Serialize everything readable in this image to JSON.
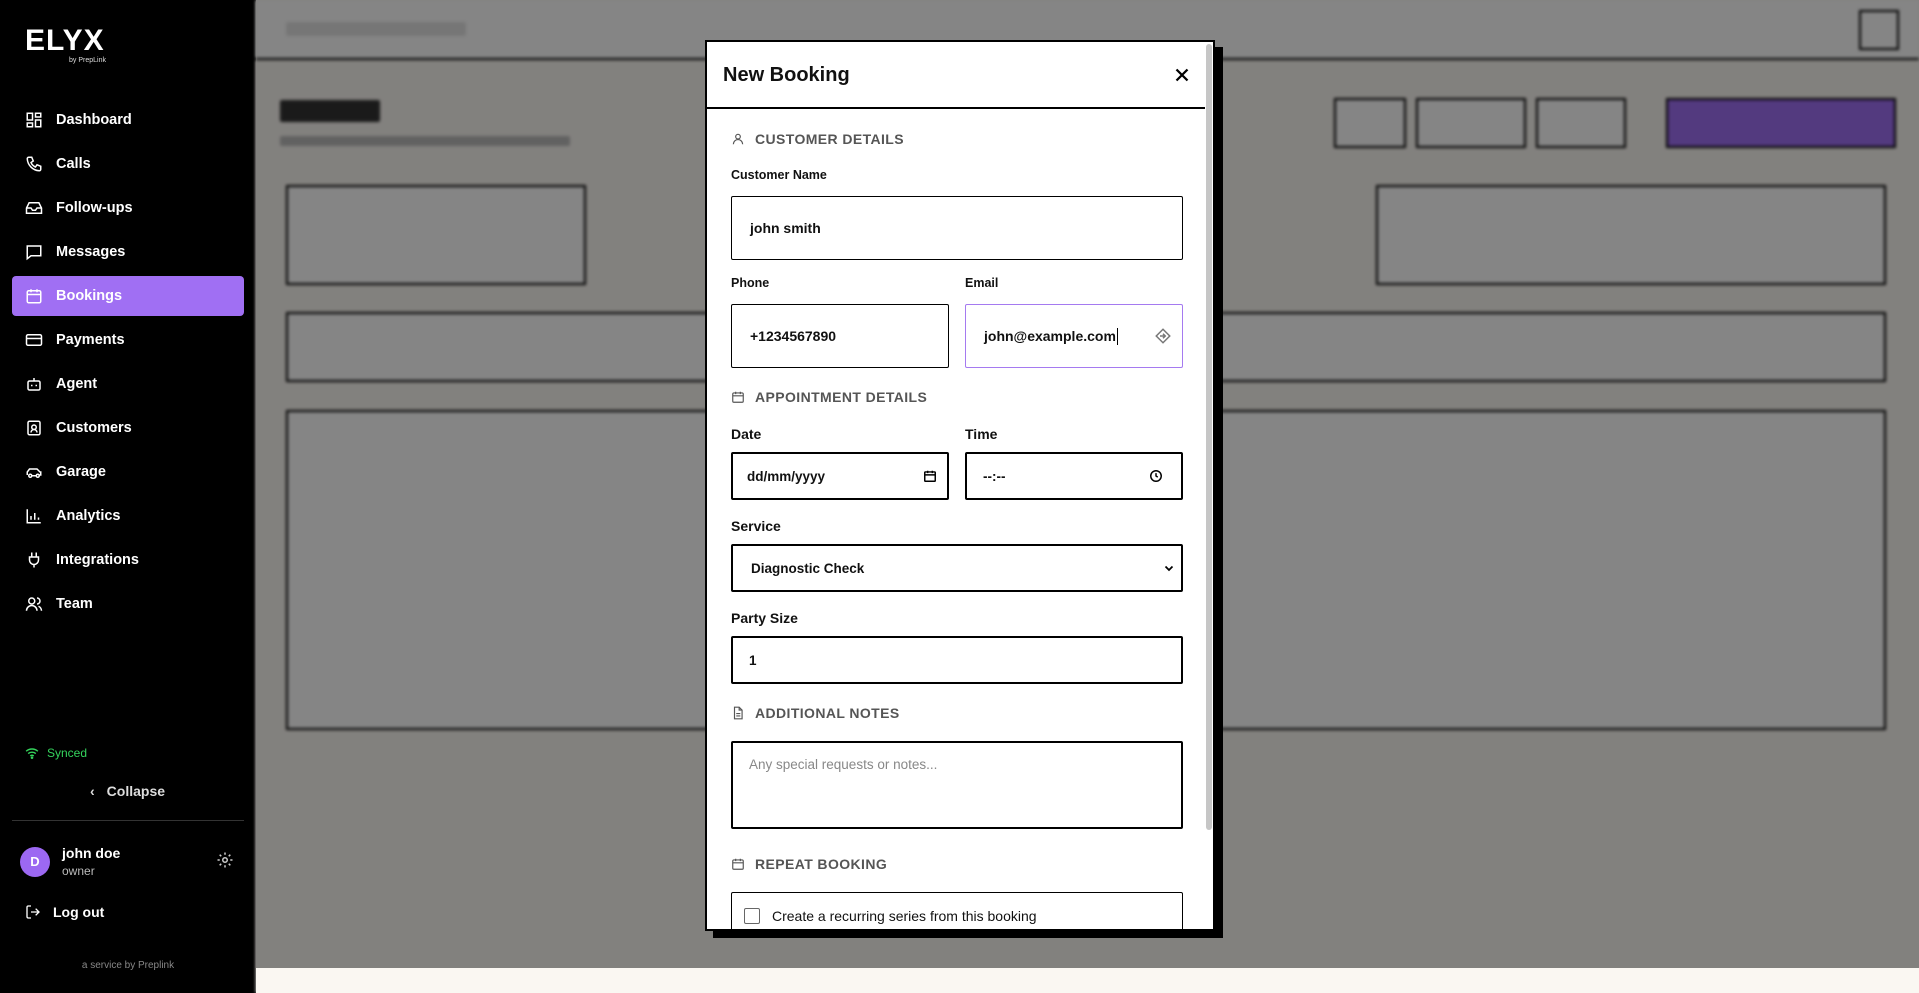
{
  "brand": {
    "name": "ELYX",
    "tagline": "by PrepLink"
  },
  "sidebar": {
    "items": [
      {
        "label": "Dashboard",
        "icon": "grid-icon"
      },
      {
        "label": "Calls",
        "icon": "phone-icon"
      },
      {
        "label": "Follow-ups",
        "icon": "inbox-icon"
      },
      {
        "label": "Messages",
        "icon": "message-icon"
      },
      {
        "label": "Bookings",
        "icon": "calendar-icon",
        "active": true
      },
      {
        "label": "Payments",
        "icon": "card-icon"
      },
      {
        "label": "Agent",
        "icon": "bot-icon"
      },
      {
        "label": "Customers",
        "icon": "contact-icon"
      },
      {
        "label": "Garage",
        "icon": "car-icon"
      },
      {
        "label": "Analytics",
        "icon": "chart-icon"
      },
      {
        "label": "Integrations",
        "icon": "plug-icon"
      },
      {
        "label": "Team",
        "icon": "users-icon"
      }
    ],
    "sync_status": "Synced",
    "collapse_label": "Collapse",
    "user": {
      "initial": "D",
      "name": "john doe",
      "role": "owner"
    },
    "logout_label": "Log out",
    "footer": "a service by Preplink"
  },
  "modal": {
    "title": "New Booking",
    "customer_section": "CUSTOMER DETAILS",
    "customer_name_label": "Customer Name",
    "customer_name_value": "john smith",
    "phone_label": "Phone",
    "phone_value": "+1234567890",
    "email_label": "Email",
    "email_value": "john@example.com",
    "appointment_section": "APPOINTMENT DETAILS",
    "date_label": "Date",
    "date_value": "dd/mm/yyyy",
    "time_label": "Time",
    "time_value": "--:--",
    "service_label": "Service",
    "service_value": "Diagnostic Check",
    "party_label": "Party Size",
    "party_value": "1",
    "notes_section": "ADDITIONAL NOTES",
    "notes_placeholder": "Any special requests or notes...",
    "repeat_section": "REPEAT BOOKING",
    "recurring_label": "Create a recurring series from this booking"
  },
  "colors": {
    "accent": "#a06ff3",
    "synced": "#34d35c",
    "sidebar": "#000000"
  }
}
